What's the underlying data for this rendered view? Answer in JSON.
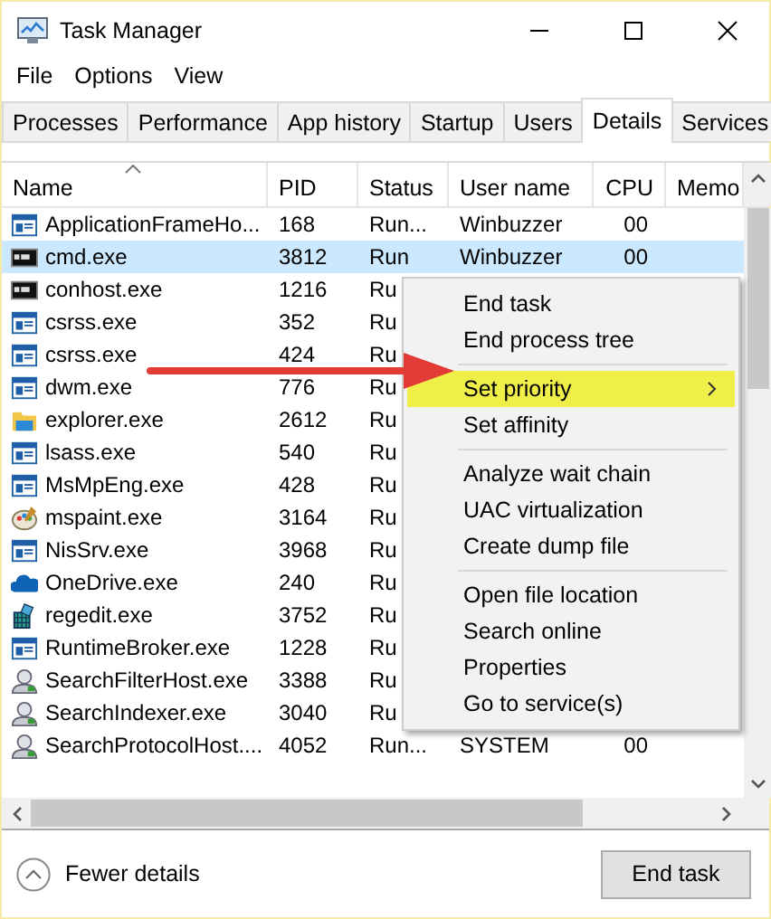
{
  "window": {
    "title": "Task Manager"
  },
  "menu_bar": [
    "File",
    "Options",
    "View"
  ],
  "tabs": [
    {
      "label": "Processes",
      "selected": false
    },
    {
      "label": "Performance",
      "selected": false
    },
    {
      "label": "App history",
      "selected": false
    },
    {
      "label": "Startup",
      "selected": false
    },
    {
      "label": "Users",
      "selected": false
    },
    {
      "label": "Details",
      "selected": true
    },
    {
      "label": "Services",
      "selected": false
    }
  ],
  "table": {
    "columns": [
      "Name",
      "PID",
      "Status",
      "User name",
      "CPU",
      "Memo"
    ],
    "rows": [
      {
        "kind": "window",
        "name": "ApplicationFrameHo...",
        "pid": "168",
        "status": "Run...",
        "user": "Winbuzzer",
        "cpu": "00",
        "selected": false
      },
      {
        "kind": "console",
        "name": "cmd.exe",
        "pid": "3812",
        "status": "Run",
        "user": "Winbuzzer",
        "cpu": "00",
        "selected": true
      },
      {
        "kind": "console",
        "name": "conhost.exe",
        "pid": "1216",
        "status": "Ru",
        "selected": false
      },
      {
        "kind": "window",
        "name": "csrss.exe",
        "pid": "352",
        "status": "Ru",
        "selected": false
      },
      {
        "kind": "window",
        "name": "csrss.exe",
        "pid": "424",
        "status": "Ru",
        "selected": false
      },
      {
        "kind": "window",
        "name": "dwm.exe",
        "pid": "776",
        "status": "Ru",
        "selected": false
      },
      {
        "kind": "folder",
        "name": "explorer.exe",
        "pid": "2612",
        "status": "Ru",
        "selected": false
      },
      {
        "kind": "window",
        "name": "lsass.exe",
        "pid": "540",
        "status": "Ru",
        "selected": false
      },
      {
        "kind": "window",
        "name": "MsMpEng.exe",
        "pid": "428",
        "status": "Ru",
        "selected": false
      },
      {
        "kind": "palette",
        "name": "mspaint.exe",
        "pid": "3164",
        "status": "Ru",
        "selected": false
      },
      {
        "kind": "window",
        "name": "NisSrv.exe",
        "pid": "3968",
        "status": "Ru",
        "selected": false
      },
      {
        "kind": "cloud",
        "name": "OneDrive.exe",
        "pid": "240",
        "status": "Ru",
        "selected": false
      },
      {
        "kind": "cubes",
        "name": "regedit.exe",
        "pid": "3752",
        "status": "Ru",
        "selected": false
      },
      {
        "kind": "window",
        "name": "RuntimeBroker.exe",
        "pid": "1228",
        "status": "Ru",
        "selected": false
      },
      {
        "kind": "person",
        "name": "SearchFilterHost.exe",
        "pid": "3388",
        "status": "Ru",
        "selected": false
      },
      {
        "kind": "person",
        "name": "SearchIndexer.exe",
        "pid": "3040",
        "status": "Ru",
        "selected": false
      },
      {
        "kind": "person",
        "name": "SearchProtocolHost....",
        "pid": "4052",
        "status": "Run...",
        "user": "SYSTEM",
        "cpu": "00",
        "selected": false
      }
    ]
  },
  "context_menu": [
    {
      "kind": "item",
      "label": "End task",
      "selected": false
    },
    {
      "kind": "item",
      "label": "End process tree",
      "selected": false
    },
    {
      "kind": "separator"
    },
    {
      "kind": "item",
      "label": "Set priority",
      "selected": true,
      "submenu": true
    },
    {
      "kind": "item",
      "label": "Set affinity",
      "selected": false
    },
    {
      "kind": "separator"
    },
    {
      "kind": "item",
      "label": "Analyze wait chain",
      "selected": false
    },
    {
      "kind": "item",
      "label": "UAC virtualization",
      "selected": false
    },
    {
      "kind": "item",
      "label": "Create dump file",
      "selected": false
    },
    {
      "kind": "separator"
    },
    {
      "kind": "item",
      "label": "Open file location",
      "selected": false
    },
    {
      "kind": "item",
      "label": "Search online",
      "selected": false
    },
    {
      "kind": "item",
      "label": "Properties",
      "selected": false
    },
    {
      "kind": "item",
      "label": "Go to service(s)",
      "selected": false
    }
  ],
  "footer": {
    "toggle": "Fewer details",
    "button": "End task"
  }
}
